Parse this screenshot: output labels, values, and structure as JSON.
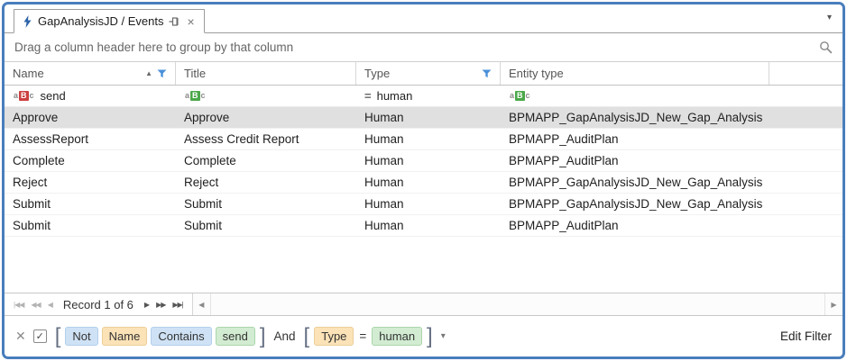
{
  "tab": {
    "title": "GapAnalysisJD / Events"
  },
  "tabbar": {
    "dropdown_icon": "▾"
  },
  "group_panel": {
    "hint": "Drag a column header here to group by that column"
  },
  "grid": {
    "columns": [
      {
        "label": "Name",
        "sorted": "asc",
        "filtered": true
      },
      {
        "label": "Title",
        "sorted": null,
        "filtered": false
      },
      {
        "label": "Type",
        "sorted": null,
        "filtered": true
      },
      {
        "label": "Entity type",
        "sorted": null,
        "filtered": false
      }
    ],
    "filter_row": {
      "name_value": "send",
      "title_value": "",
      "type_operator": "=",
      "type_value": "human",
      "entity_value": ""
    },
    "rows": [
      {
        "name": "Approve",
        "title": "Approve",
        "type": "Human",
        "entity_type": "BPMAPP_GapAnalysisJD_New_Gap_Analysis",
        "selected": true
      },
      {
        "name": "AssessReport",
        "title": "Assess Credit Report",
        "type": "Human",
        "entity_type": "BPMAPP_AuditPlan",
        "selected": false
      },
      {
        "name": "Complete",
        "title": "Complete",
        "type": "Human",
        "entity_type": "BPMAPP_AuditPlan",
        "selected": false
      },
      {
        "name": "Reject",
        "title": "Reject",
        "type": "Human",
        "entity_type": "BPMAPP_GapAnalysisJD_New_Gap_Analysis",
        "selected": false
      },
      {
        "name": "Submit",
        "title": "Submit",
        "type": "Human",
        "entity_type": "BPMAPP_GapAnalysisJD_New_Gap_Analysis",
        "selected": false
      },
      {
        "name": "Submit",
        "title": "Submit",
        "type": "Human",
        "entity_type": "BPMAPP_AuditPlan",
        "selected": false
      }
    ]
  },
  "navigator": {
    "first": "|◀◀",
    "prev_page": "◀◀",
    "prev": "◀",
    "record_text": "Record 1 of 6",
    "next": "▶",
    "next_page": "▶▶",
    "last": "▶▶|",
    "scroll_left": "◀",
    "scroll_right": "▶"
  },
  "filter_panel": {
    "open_bracket": "[",
    "close_bracket": "]",
    "not_label": "Not",
    "name_field": "Name",
    "contains_operator": "Contains",
    "send_value": "send",
    "and_label": "And",
    "type_field": "Type",
    "equals_operator": "=",
    "human_value": "human",
    "dropdown_icon": "▾",
    "edit_filter_label": "Edit Filter"
  },
  "icons": {
    "close_tab": "×",
    "sort_asc": "▲",
    "abc_a": "a",
    "abc_b": "B",
    "abc_c": "c",
    "clear_filter": "✕",
    "checkbox_check": "✓"
  },
  "colors": {
    "frame_border": "#4a7ebc",
    "selected_row": "#e0e0e0",
    "filter_funnel": "#4a90d9",
    "chip_field": "#fbe2b7",
    "chip_operator": "#cfe2f5",
    "chip_value": "#d2ecd2"
  }
}
